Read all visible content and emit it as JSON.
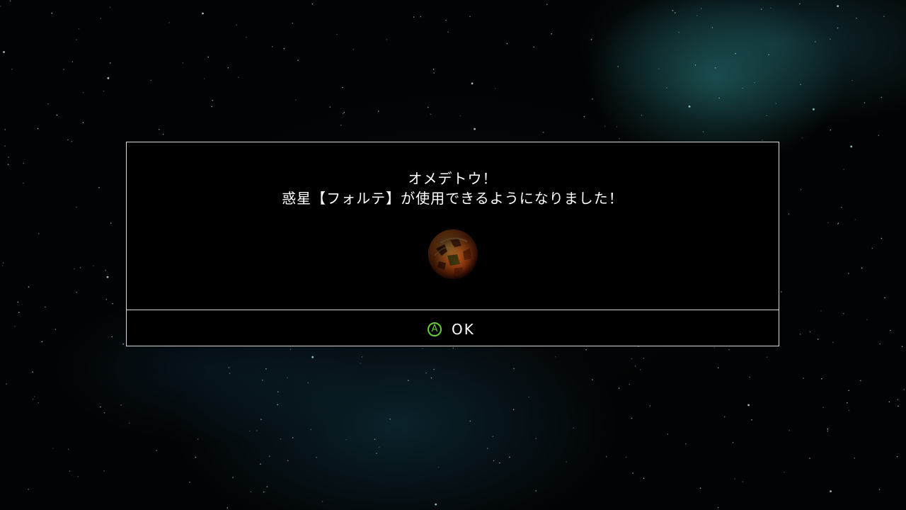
{
  "dialog": {
    "line1": "オメデトウ！",
    "line2": "惑星【フォルテ】が使用できるようになりました！",
    "planet_icon": "planet-forte-icon"
  },
  "footer": {
    "button_glyph": "A",
    "button_label": "OK",
    "button_color": "#5fd23a"
  },
  "colors": {
    "dialog_border": "#d9d9d9",
    "dialog_bg": "#000000",
    "text": "#ffffff"
  }
}
